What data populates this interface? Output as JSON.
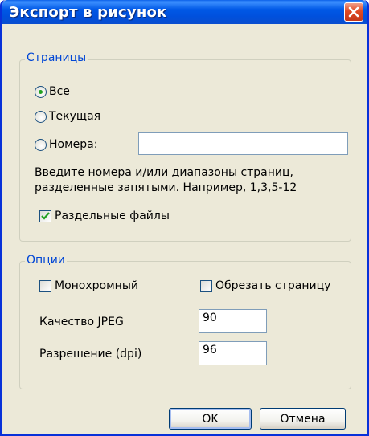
{
  "window": {
    "title": "Экспорт в рисунок"
  },
  "pages_group": {
    "legend": "Страницы",
    "radio_all": "Все",
    "radio_current": "Текущая",
    "radio_numbers": "Номера:",
    "numbers_value": "",
    "hint_line1": "Введите номера и/или диапазоны страниц,",
    "hint_line2": "разделенные запятыми. Например, 1,3,5-12",
    "separate_files": "Раздельные файлы",
    "selected": "Все",
    "separate_files_checked": true
  },
  "options_group": {
    "legend": "Опции",
    "monochrome": "Монохромный",
    "monochrome_checked": false,
    "crop_page": "Обрезать страницу",
    "crop_page_checked": false,
    "jpeg_quality_label": "Качество JPEG",
    "jpeg_quality_value": "90",
    "resolution_label": "Разрешение (dpi)",
    "resolution_value": "96"
  },
  "buttons": {
    "ok": "OK",
    "cancel": "Отмена"
  },
  "colors": {
    "title_bar": "#0054e3",
    "legend_text": "#0046d5",
    "dialog_bg": "#ece9d8",
    "close_button": "#e04a24"
  }
}
